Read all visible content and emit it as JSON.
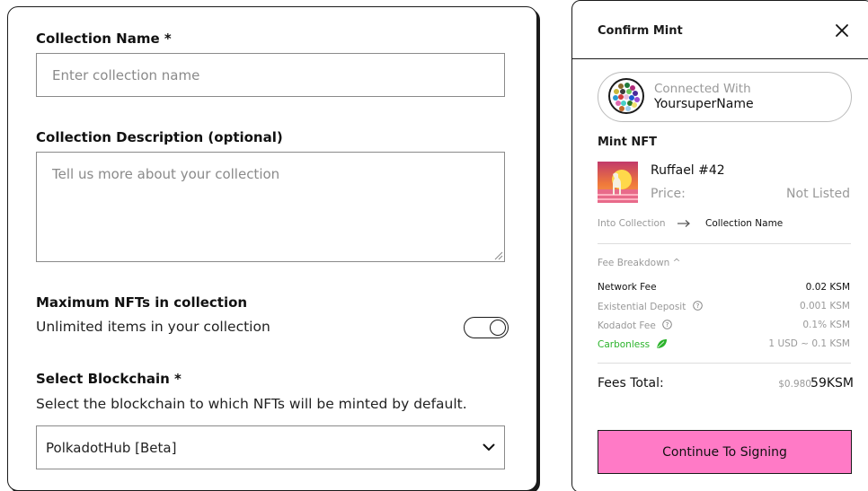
{
  "form": {
    "collection_name_label": "Collection Name *",
    "collection_name_placeholder": "Enter collection name",
    "description_label": "Collection Description (optional)",
    "description_placeholder": "Tell us more about your collection",
    "max_nfts_label": "Maximum NFTs in collection",
    "max_nfts_sub": "Unlimited items in your collection",
    "unlimited_toggle_on": false,
    "blockchain_label": "Select Blockchain *",
    "blockchain_sub": "Select the blockchain to which NFTs will be minted by default.",
    "blockchain_selected": "PolkadotHub [Beta]"
  },
  "modal": {
    "title": "Confirm Mint",
    "connected_with": "Connected With",
    "wallet_name": "YoursuperName",
    "mint_heading": "Mint NFT",
    "nft_name": "Ruffael #42",
    "price_label": "Price:",
    "price_value": "Not Listed",
    "into_collection_label": "Into Collection",
    "collection_target": "Collection Name",
    "fee_breakdown_label": "Fee Breakdown ^",
    "fees": [
      {
        "label": "Network Fee",
        "value": "0.02 KSM"
      },
      {
        "label": "Existential Deposit",
        "value": "0.001 KSM"
      },
      {
        "label": "Kodadot Fee",
        "value": "0.1% KSM"
      },
      {
        "label": "Carbonless",
        "value": "1 USD ~ 0.1 KSM"
      }
    ],
    "fees_total_label": "Fees Total:",
    "fees_total_usd": "$0.980",
    "fees_total_ksm": "59KSM",
    "continue_label": "Continue To Signing"
  },
  "colors": {
    "accent_pink": "#ff7ac6",
    "carbonless_green": "#2bb32b",
    "muted_text": "#999999"
  }
}
